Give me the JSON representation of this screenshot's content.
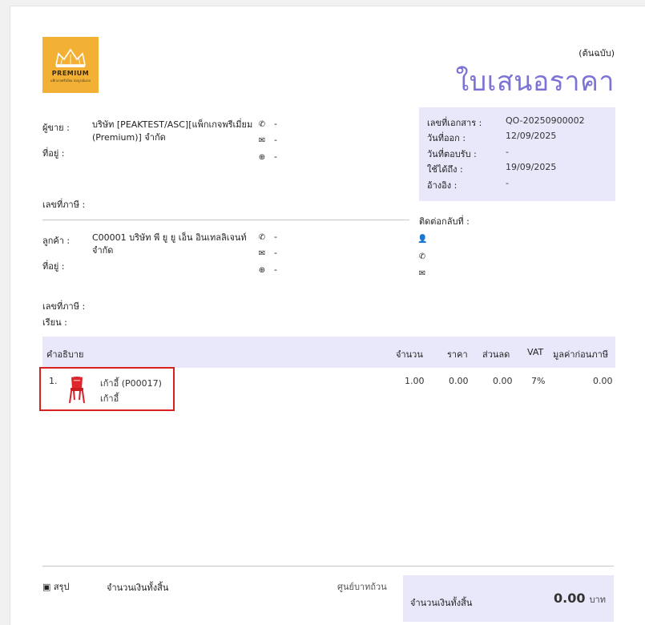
{
  "header": {
    "logo_text": "PREMIUM",
    "logo_subtext": "แพ็กเกจพรีเมี่ยม สมบูรณ์แบบ",
    "copy_label": "(ต้นฉบับ)",
    "doc_title": "ใบเสนอราคา"
  },
  "seller": {
    "label": "ผู้ขาย :",
    "name": "บริษัท [PEAKTEST/ASC][แพ็กเกจพรีเมี่ยม (Premium)] จำกัด",
    "address_label": "ที่อยู่ :",
    "tax_label": "เลขที่ภาษี :",
    "phone": "-",
    "email": "-",
    "web": "-"
  },
  "document_info": {
    "doc_no_label": "เลขที่เอกสาร :",
    "doc_no": "QO-20250900002",
    "issue_label": "วันที่ออก :",
    "issue_date": "12/09/2025",
    "accept_label": "วันที่ตอบรับ :",
    "accept_date": "-",
    "valid_label": "ใช้ได้ถึง :",
    "valid_date": "19/09/2025",
    "ref_label": "อ้างอิง :",
    "ref": "-"
  },
  "contact": {
    "label": "ติดต่อกลับที่ :"
  },
  "customer": {
    "label": "ลูกค้า :",
    "name": "C00001 บริษัท พี ยู ยู เอ็น อินเทลลิเจนท์ จำกัด",
    "address_label": "ที่อยู่ :",
    "tax_label": "เลขที่ภาษี :",
    "attn_label": "เรียน :",
    "phone": "-",
    "email": "-",
    "web": "-"
  },
  "table": {
    "headers": {
      "desc": "คำอธิบาย",
      "qty": "จำนวน",
      "price": "ราคา",
      "discount": "ส่วนลด",
      "vat": "VAT",
      "amount": "มูลค่าก่อนภาษี"
    },
    "rows": [
      {
        "no": "1.",
        "name": "เก้าอี้",
        "code": "(P00017)",
        "desc": "เก้าอี้",
        "qty": "1.00",
        "price": "0.00",
        "discount": "0.00",
        "vat": "7%",
        "amount": "0.00"
      }
    ]
  },
  "summary": {
    "label": "สรุป",
    "total_label": "จำนวนเงินทั้งสิ้น",
    "amount_words": "ศูนย์บาทถ้วน",
    "box_label": "จำนวนเงินทั้งสิ้น",
    "total_value": "0.00",
    "currency": "บาท"
  },
  "colors": {
    "title": "#7b74d6",
    "panel": "#e9e8fb",
    "logo_bg": "#f2b135",
    "highlight": "#d9201c",
    "chair": "#e0262a"
  }
}
